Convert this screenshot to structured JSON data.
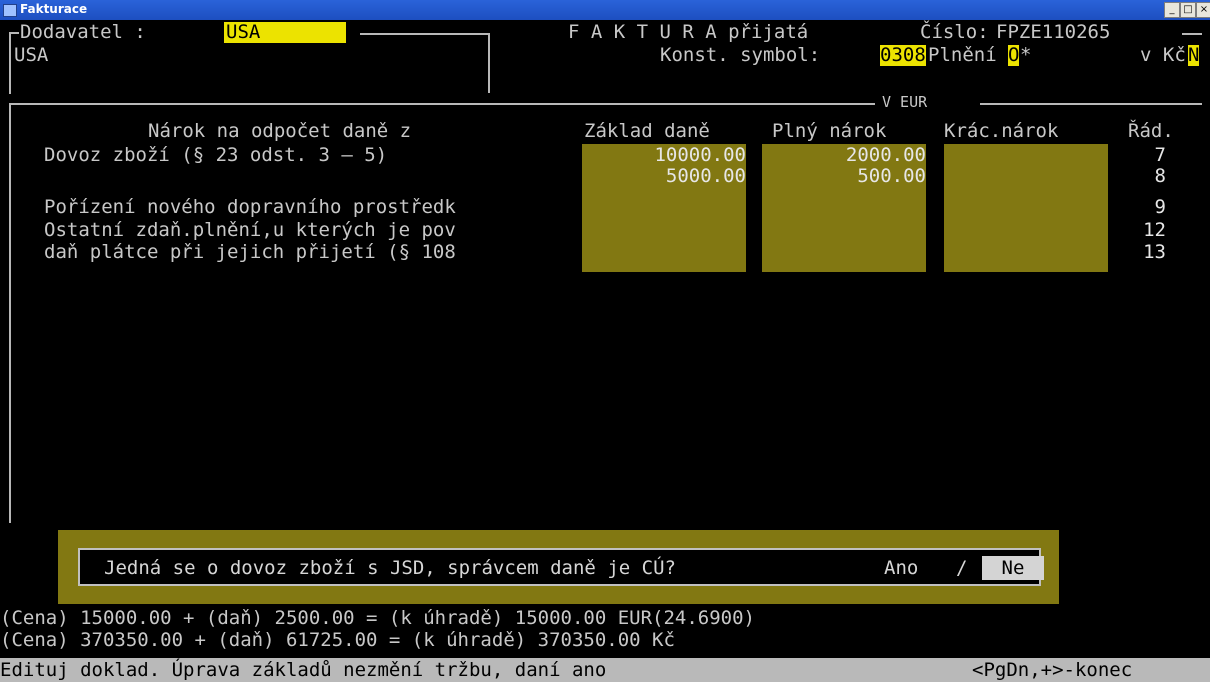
{
  "window": {
    "title": "Fakturace",
    "buttons": [
      "_",
      "□",
      "×"
    ]
  },
  "header": {
    "supplier_label": "Dodavatel :",
    "supplier_value": "USA",
    "supplier_name": "USA",
    "invoice_title": "F A K T U R A přijatá",
    "number_label": "Číslo:",
    "number_value": "FPZE110265",
    "ks_label": "Konst. symbol:",
    "ks_value": "0308",
    "plneni_label": "Plnění",
    "plneni_value": "O",
    "plneni_suffix": "*",
    "currency_label": "v Kč",
    "currency_value": "N",
    "currency_note": "V EUR"
  },
  "table": {
    "columns": [
      "Nárok na odpočet daně z",
      "Základ daně",
      "Plný nárok",
      "Krác.nárok",
      "Řád."
    ],
    "rows": [
      {
        "label": "Dovoz zboží (§ 23 odst. 3 – 5)",
        "zaklad": "10000.00",
        "plny": "2000.00",
        "krac": "",
        "rad": "7"
      },
      {
        "label": "",
        "zaklad": "5000.00",
        "plny": "500.00",
        "krac": "",
        "rad": "8"
      },
      {
        "label": "Pořízení nového dopravního prostředk",
        "zaklad": "",
        "plny": "",
        "krac": "",
        "rad": "9"
      },
      {
        "label": "Ostatní zdaň.plnění,u kterých je pov",
        "zaklad": "",
        "plny": "",
        "krac": "",
        "rad": "12"
      },
      {
        "label": "daň plátce při jejich přijetí (§ 108",
        "zaklad": "",
        "plny": "",
        "krac": "",
        "rad": "13"
      }
    ]
  },
  "dialog": {
    "question": "Jedná se o dovoz zboží s JSD, správcem daně je CÚ?",
    "yes_label": "Ano",
    "separator": "/",
    "no_label": "Ne"
  },
  "totals": {
    "line1": "(Cena) 15000.00 + (daň) 2500.00 = (k úhradě) 15000.00 EUR(24.6900)",
    "line2": "(Cena) 370350.00 + (daň) 61725.00 = (k úhradě) 370350.00 Kč"
  },
  "status": {
    "left": "Edituj doklad. Úprava základů nezmění tržbu, daní ano",
    "right": "<PgDn,+>-konec"
  }
}
